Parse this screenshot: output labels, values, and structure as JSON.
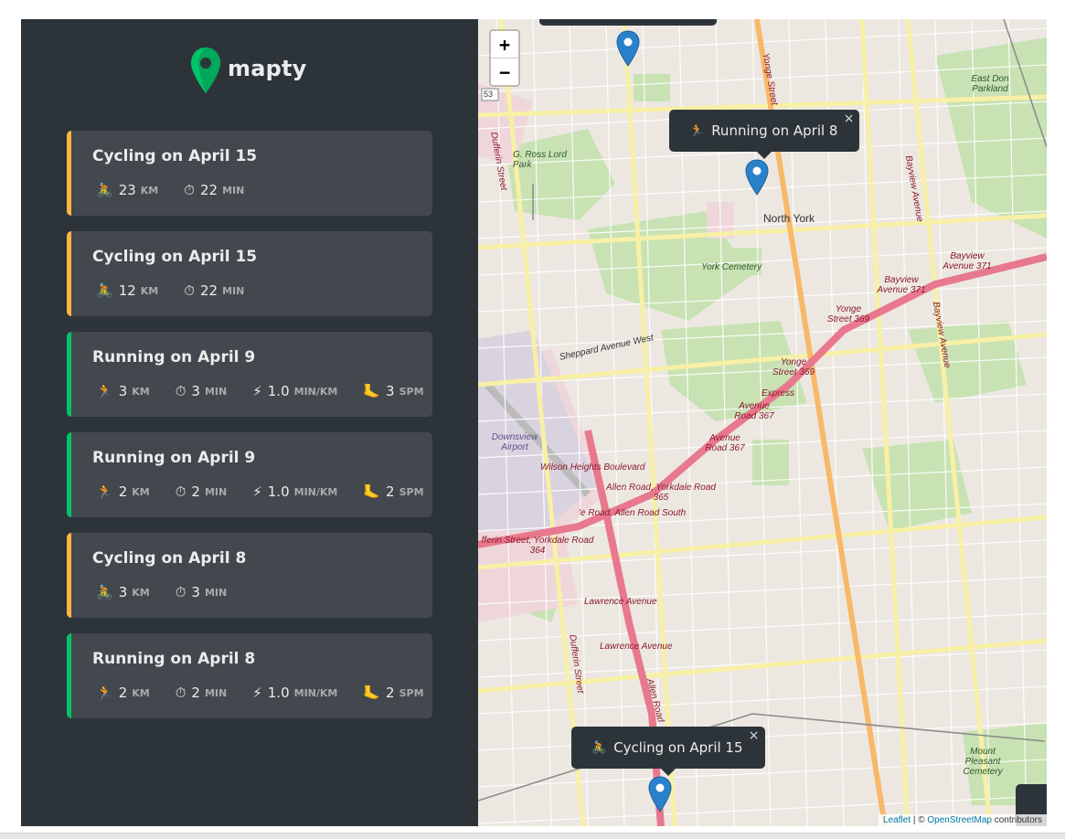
{
  "app": {
    "name": "mapty"
  },
  "colors": {
    "sidebar_bg": "#2d3439",
    "card_bg": "#42484d",
    "cycling": "#ffb545",
    "running": "#00c46a",
    "marker": "#2a81cb"
  },
  "workouts": [
    {
      "type": "cycling",
      "title": "Cycling on April 15",
      "details": [
        {
          "icon": "cyclist-icon",
          "glyph": "🚴",
          "value": "23",
          "unit": "KM"
        },
        {
          "icon": "stopwatch-icon",
          "glyph": "⏱",
          "value": "22",
          "unit": "MIN"
        }
      ]
    },
    {
      "type": "cycling",
      "title": "Cycling on April 15",
      "details": [
        {
          "icon": "cyclist-icon",
          "glyph": "🚴",
          "value": "12",
          "unit": "KM"
        },
        {
          "icon": "stopwatch-icon",
          "glyph": "⏱",
          "value": "22",
          "unit": "MIN"
        }
      ]
    },
    {
      "type": "running",
      "title": "Running on April 9",
      "details": [
        {
          "icon": "runner-icon",
          "glyph": "🏃",
          "value": "3",
          "unit": "KM"
        },
        {
          "icon": "stopwatch-icon",
          "glyph": "⏱",
          "value": "3",
          "unit": "MIN"
        },
        {
          "icon": "lightning-icon",
          "glyph": "⚡",
          "value": "1.0",
          "unit": "MIN/KM"
        },
        {
          "icon": "foot-icon",
          "glyph": "🦶",
          "value": "3",
          "unit": "SPM"
        }
      ]
    },
    {
      "type": "running",
      "title": "Running on April 9",
      "details": [
        {
          "icon": "runner-icon",
          "glyph": "🏃",
          "value": "2",
          "unit": "KM"
        },
        {
          "icon": "stopwatch-icon",
          "glyph": "⏱",
          "value": "2",
          "unit": "MIN"
        },
        {
          "icon": "lightning-icon",
          "glyph": "⚡",
          "value": "1.0",
          "unit": "MIN/KM"
        },
        {
          "icon": "foot-icon",
          "glyph": "🦶",
          "value": "2",
          "unit": "SPM"
        }
      ]
    },
    {
      "type": "cycling",
      "title": "Cycling on April 8",
      "details": [
        {
          "icon": "cyclist-icon",
          "glyph": "🚴",
          "value": "3",
          "unit": "KM"
        },
        {
          "icon": "stopwatch-icon",
          "glyph": "⏱",
          "value": "3",
          "unit": "MIN"
        }
      ]
    },
    {
      "type": "running",
      "title": "Running on April 8",
      "details": [
        {
          "icon": "runner-icon",
          "glyph": "🏃",
          "value": "2",
          "unit": "KM"
        },
        {
          "icon": "stopwatch-icon",
          "glyph": "⏱",
          "value": "2",
          "unit": "MIN"
        },
        {
          "icon": "lightning-icon",
          "glyph": "⚡",
          "value": "1.0",
          "unit": "MIN/KM"
        },
        {
          "icon": "foot-icon",
          "glyph": "🦶",
          "value": "2",
          "unit": "SPM"
        }
      ]
    }
  ],
  "map": {
    "zoom_in": "+",
    "zoom_out": "−",
    "popups": [
      {
        "icon": "runner-icon",
        "glyph": "🏃",
        "text": "Running on April 8",
        "close": "×"
      },
      {
        "icon": "cyclist-icon",
        "glyph": "🚴",
        "text": "Cycling on April 15",
        "close": "×"
      }
    ],
    "labels": {
      "north_york": "North York",
      "york_cemetery": "York Cemetery",
      "downsview_airport": "Downsview Airport",
      "g_ross_lord_park": "G. Ross Lord Park",
      "east_don_parkland": "East Don Parkland",
      "mount_pleasant_cemetery": "Mount Pleasant Cemetery",
      "yonge_street": "Yonge Street",
      "yonge_street_369": "Yonge Street 369",
      "bayview_avenue": "Bayview Avenue",
      "bayview_avenue_371": "Bayview Avenue 371",
      "sheppard_avenue_west": "Sheppard Avenue West",
      "avenue_road_367": "Avenue Road 367",
      "express": "Express",
      "wilson_heights": "Wilson Heights Boulevard",
      "allen_yorkdale_365": "Allen Road, Yorkdale Road 365",
      "allen_road_south": "'e Road, Allen Road South",
      "dufferin_yorkdale_364": "fferin Street, Yorkdale Road 364",
      "lawrence_avenue": "Lawrence Avenue",
      "dufferin_street": "Dufferin Street",
      "allen_road": "Allen Road",
      "route_53": "53"
    },
    "attribution": {
      "leaflet": "Leaflet",
      "sep": " | © ",
      "osm": "OpenStreetMap",
      "suffix": " contributors"
    }
  }
}
